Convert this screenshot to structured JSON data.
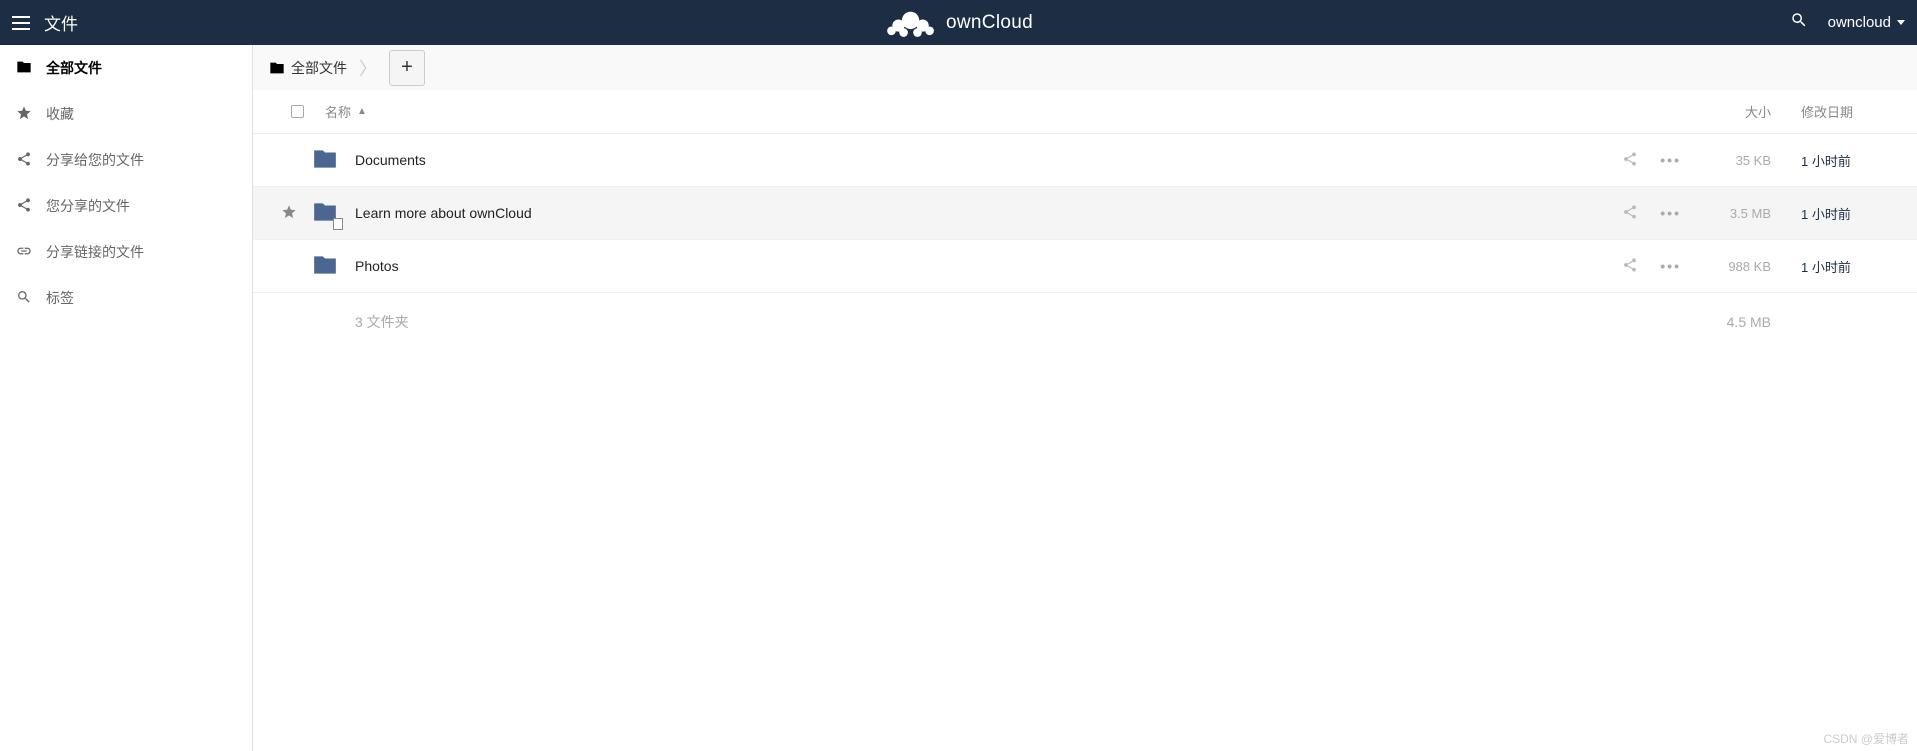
{
  "header": {
    "app_label": "文件",
    "brand": "ownCloud",
    "user_name": "owncloud"
  },
  "sidebar": {
    "items": [
      {
        "label": "全部文件",
        "icon": "folder",
        "active": true
      },
      {
        "label": "收藏",
        "icon": "star",
        "active": false
      },
      {
        "label": "分享给您的文件",
        "icon": "share",
        "active": false
      },
      {
        "label": "您分享的文件",
        "icon": "share",
        "active": false
      },
      {
        "label": "分享链接的文件",
        "icon": "link",
        "active": false
      },
      {
        "label": "标签",
        "icon": "search",
        "active": false
      }
    ]
  },
  "breadcrumb": {
    "root_label": "全部文件"
  },
  "table": {
    "headers": {
      "name": "名称",
      "size": "大小",
      "date": "修改日期"
    },
    "rows": [
      {
        "name": "Documents",
        "size": "35 KB",
        "date": "1 小时前",
        "starred": false,
        "shared": false
      },
      {
        "name": "Learn more about ownCloud",
        "size": "3.5 MB",
        "date": "1 小时前",
        "starred": true,
        "shared": true
      },
      {
        "name": "Photos",
        "size": "988 KB",
        "date": "1 小时前",
        "starred": false,
        "shared": false
      }
    ],
    "summary": {
      "count": "3 文件夹",
      "total_size": "4.5 MB"
    }
  },
  "watermark": "CSDN @爱博者"
}
